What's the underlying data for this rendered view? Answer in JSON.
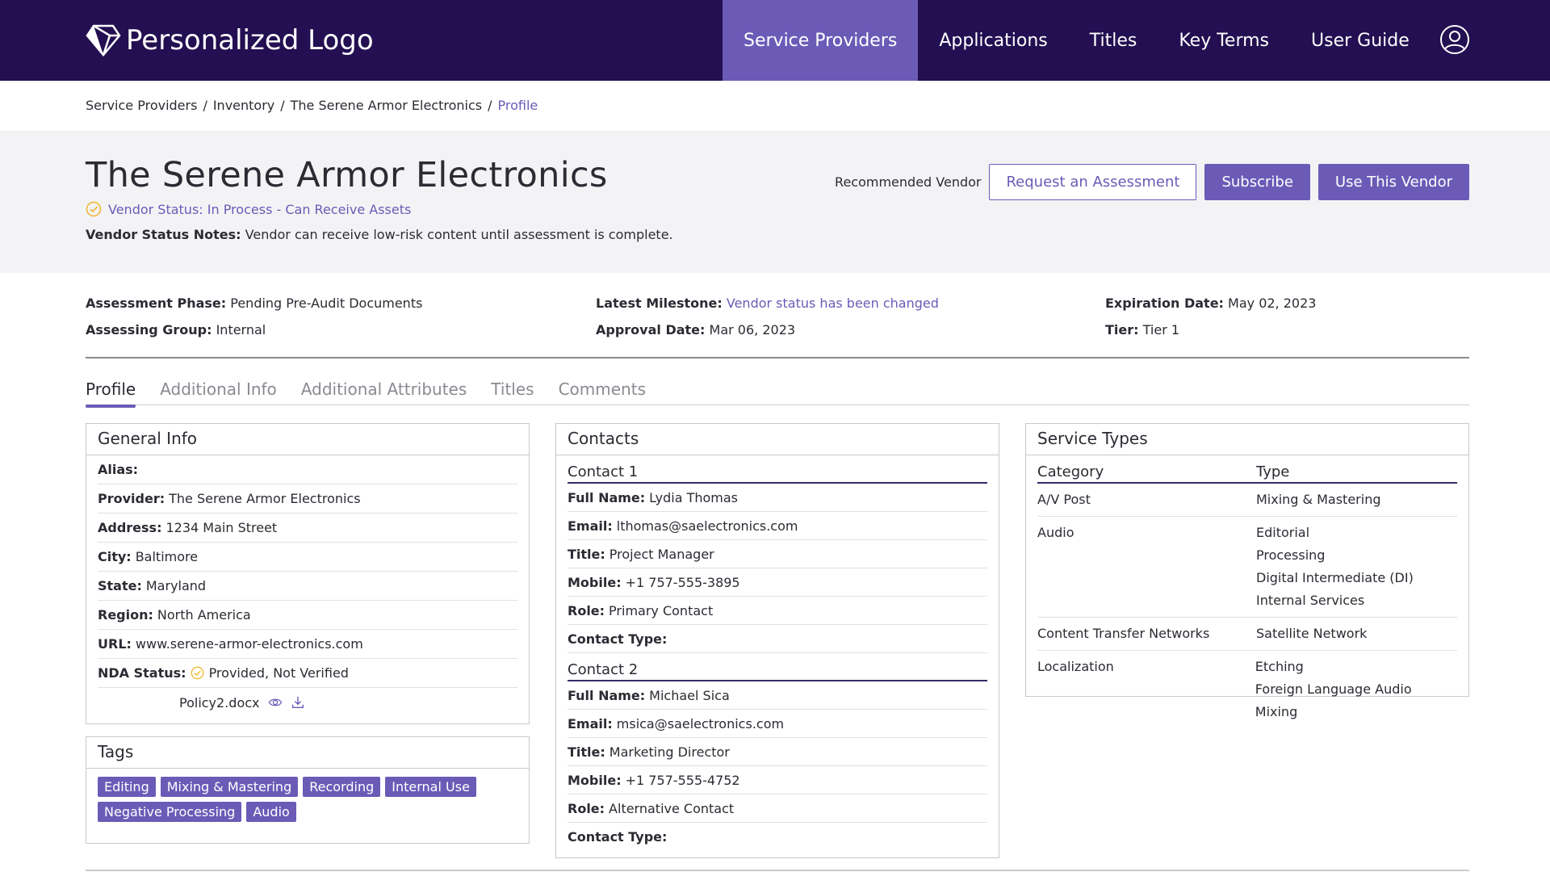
{
  "nav": {
    "logo_text": "Personalized Logo",
    "items": [
      {
        "label": "Service Providers",
        "active": true
      },
      {
        "label": "Applications"
      },
      {
        "label": "Titles"
      },
      {
        "label": "Key Terms"
      },
      {
        "label": "User Guide"
      }
    ],
    "user_icon": "user-circle-icon"
  },
  "breadcrumb": {
    "items": [
      "Service Providers",
      "Inventory",
      "The Serene Armor Electronics",
      "Profile"
    ],
    "separator": "/"
  },
  "header": {
    "title": "The Serene Armor Electronics",
    "status_text": "Vendor Status: In Process - Can Receive Assets",
    "status_icon": "check-circle-icon",
    "notes_label": "Vendor Status Notes:",
    "notes_value": "Vendor can receive low-risk content until assessment is complete.",
    "recommended_label": "Recommended Vendor",
    "request_button": "Request an Assessment",
    "subscribe_button": "Subscribe",
    "use_button": "Use This Vendor"
  },
  "meta": {
    "assessment_phase_label": "Assessment Phase:",
    "assessment_phase_value": "Pending Pre-Audit Documents",
    "assessing_group_label": "Assessing Group:",
    "assessing_group_value": "Internal",
    "latest_milestone_label": "Latest Milestone:",
    "latest_milestone_value": "Vendor status has been changed",
    "approval_date_label": "Approval Date:",
    "approval_date_value": "Mar 06, 2023",
    "expiration_date_label": "Expiration Date:",
    "expiration_date_value": "May 02, 2023",
    "tier_label": "Tier:",
    "tier_value": "Tier 1"
  },
  "tabs": [
    "Profile",
    "Additional Info",
    "Additional Attributes",
    "Titles",
    "Comments"
  ],
  "general_info": {
    "title": "General Info",
    "fields": [
      {
        "label": "Alias:",
        "value": ""
      },
      {
        "label": "Provider:",
        "value": "The Serene Armor Electronics"
      },
      {
        "label": "Address:",
        "value": "1234 Main Street"
      },
      {
        "label": "City:",
        "value": "Baltimore"
      },
      {
        "label": "State:",
        "value": "Maryland"
      },
      {
        "label": "Region:",
        "value": "North America"
      },
      {
        "label": "URL:",
        "value": "www.serene-armor-electronics.com"
      }
    ],
    "nda_label": "NDA Status:",
    "nda_value": "Provided, Not Verified",
    "file_name": "Policy2.docx"
  },
  "tags": {
    "title": "Tags",
    "items": [
      "Editing",
      "Mixing & Mastering",
      "Recording",
      "Internal Use",
      "Negative Processing",
      "Audio"
    ]
  },
  "contacts": {
    "title": "Contacts",
    "list": [
      {
        "heading": "Contact 1",
        "fields": [
          {
            "label": "Full Name:",
            "value": "Lydia Thomas"
          },
          {
            "label": "Email:",
            "value": "lthomas@saelectronics.com"
          },
          {
            "label": "Title:",
            "value": "Project Manager"
          },
          {
            "label": "Mobile:",
            "value": "+1 757-555-3895"
          },
          {
            "label": "Role:",
            "value": "Primary Contact"
          },
          {
            "label": "Contact Type:",
            "value": ""
          }
        ]
      },
      {
        "heading": "Contact 2",
        "fields": [
          {
            "label": "Full Name:",
            "value": "Michael Sica"
          },
          {
            "label": "Email:",
            "value": "msica@saelectronics.com"
          },
          {
            "label": "Title:",
            "value": "Marketing Director"
          },
          {
            "label": "Mobile:",
            "value": "+1 757-555-4752"
          },
          {
            "label": "Role:",
            "value": "Alternative Contact"
          },
          {
            "label": "Contact Type:",
            "value": ""
          }
        ]
      }
    ]
  },
  "service_types": {
    "title": "Service Types",
    "col_category": "Category",
    "col_type": "Type",
    "rows": [
      {
        "category": "A/V Post",
        "types": [
          "Mixing & Mastering"
        ]
      },
      {
        "category": "Audio",
        "types": [
          "Editorial",
          "Processing",
          "Digital Intermediate (DI)",
          "Internal Services"
        ]
      },
      {
        "category": "Content Transfer Networks",
        "types": [
          "Satellite Network"
        ]
      },
      {
        "category": "Localization",
        "types": [
          "Etching",
          "Foreign Language Audio Mixing"
        ]
      }
    ]
  },
  "colors": {
    "nav_bg": "#230f51",
    "accent": "#6b5bb7",
    "status_icon": "#f0b429",
    "header_band": "#f3f3f5"
  }
}
